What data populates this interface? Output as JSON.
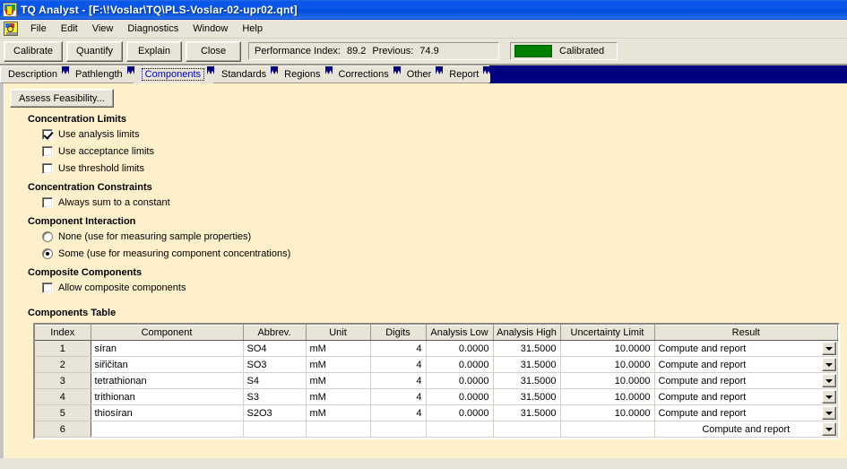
{
  "window": {
    "app_name": "TQ Analyst",
    "title": "TQ Analyst  - [F:\\!Voslar\\TQ\\PLS-Voslar-02-upr02.qnt]",
    "icon": "tq-logo-icon"
  },
  "menubar": {
    "icon": "document-icon",
    "items": [
      {
        "label": "File"
      },
      {
        "label": "Edit"
      },
      {
        "label": "View"
      },
      {
        "label": "Diagnostics"
      },
      {
        "label": "Window"
      },
      {
        "label": "Help"
      }
    ]
  },
  "toolbar": {
    "buttons": [
      {
        "label": "Calibrate"
      },
      {
        "label": "Quantify"
      },
      {
        "label": "Explain"
      },
      {
        "label": "Close"
      }
    ],
    "performance": {
      "index_label": "Performance Index:",
      "index_value": "89.2",
      "previous_label": "Previous:",
      "previous_value": "74.9"
    },
    "status": {
      "label": "Calibrated",
      "color": "#008000"
    }
  },
  "tabs": {
    "active_index": 2,
    "items": [
      {
        "label": "Description"
      },
      {
        "label": "Pathlength"
      },
      {
        "label": "Components"
      },
      {
        "label": "Standards"
      },
      {
        "label": "Regions"
      },
      {
        "label": "Corrections"
      },
      {
        "label": "Other"
      },
      {
        "label": "Report"
      }
    ]
  },
  "form": {
    "assess_button": "Assess Feasibility...",
    "groups": [
      {
        "heading": "Concentration Limits",
        "options": [
          {
            "type": "checkbox",
            "label": "Use analysis limits",
            "checked": true
          },
          {
            "type": "checkbox",
            "label": "Use acceptance limits",
            "checked": false
          },
          {
            "type": "checkbox",
            "label": "Use threshold limits",
            "checked": false
          }
        ]
      },
      {
        "heading": "Concentration Constraints",
        "options": [
          {
            "type": "checkbox",
            "label": "Always sum to a constant",
            "checked": false
          }
        ]
      },
      {
        "heading": "Component Interaction",
        "options": [
          {
            "type": "radio",
            "label": "None (use for measuring sample properties)",
            "checked": false
          },
          {
            "type": "radio",
            "label": "Some (use for measuring component concentrations)",
            "checked": true
          }
        ]
      },
      {
        "heading": "Composite Components",
        "options": [
          {
            "type": "checkbox",
            "label": "Allow composite components",
            "checked": false
          }
        ]
      }
    ],
    "table_heading": "Components Table"
  },
  "components_table": {
    "columns": [
      "Index",
      "Component",
      "Abbrev.",
      "Unit",
      "Digits",
      "Analysis Low",
      "Analysis High",
      "Uncertainty Limit",
      "Result"
    ],
    "rows": [
      {
        "index": "1",
        "component": "síran",
        "abbrev": "SO4",
        "unit": "mM",
        "digits": "4",
        "analysis_low": "0.0000",
        "analysis_high": "31.5000",
        "uncertainty_limit": "10.0000",
        "result": "Compute and report"
      },
      {
        "index": "2",
        "component": "siřičitan",
        "abbrev": "SO3",
        "unit": "mM",
        "digits": "4",
        "analysis_low": "0.0000",
        "analysis_high": "31.5000",
        "uncertainty_limit": "10.0000",
        "result": "Compute and report"
      },
      {
        "index": "3",
        "component": "tetrathionan",
        "abbrev": "S4",
        "unit": "mM",
        "digits": "4",
        "analysis_low": "0.0000",
        "analysis_high": "31.5000",
        "uncertainty_limit": "10.0000",
        "result": "Compute and report"
      },
      {
        "index": "4",
        "component": "trithionan",
        "abbrev": "S3",
        "unit": "mM",
        "digits": "4",
        "analysis_low": "0.0000",
        "analysis_high": "31.5000",
        "uncertainty_limit": "10.0000",
        "result": "Compute and report"
      },
      {
        "index": "5",
        "component": "thiosíran",
        "abbrev": "S2O3",
        "unit": "mM",
        "digits": "4",
        "analysis_low": "0.0000",
        "analysis_high": "31.5000",
        "uncertainty_limit": "10.0000",
        "result": "Compute and report"
      },
      {
        "index": "6",
        "component": "",
        "abbrev": "",
        "unit": "",
        "digits": "",
        "analysis_low": "",
        "analysis_high": "",
        "uncertainty_limit": "",
        "result": "Compute and report",
        "result_centered": true
      }
    ]
  }
}
